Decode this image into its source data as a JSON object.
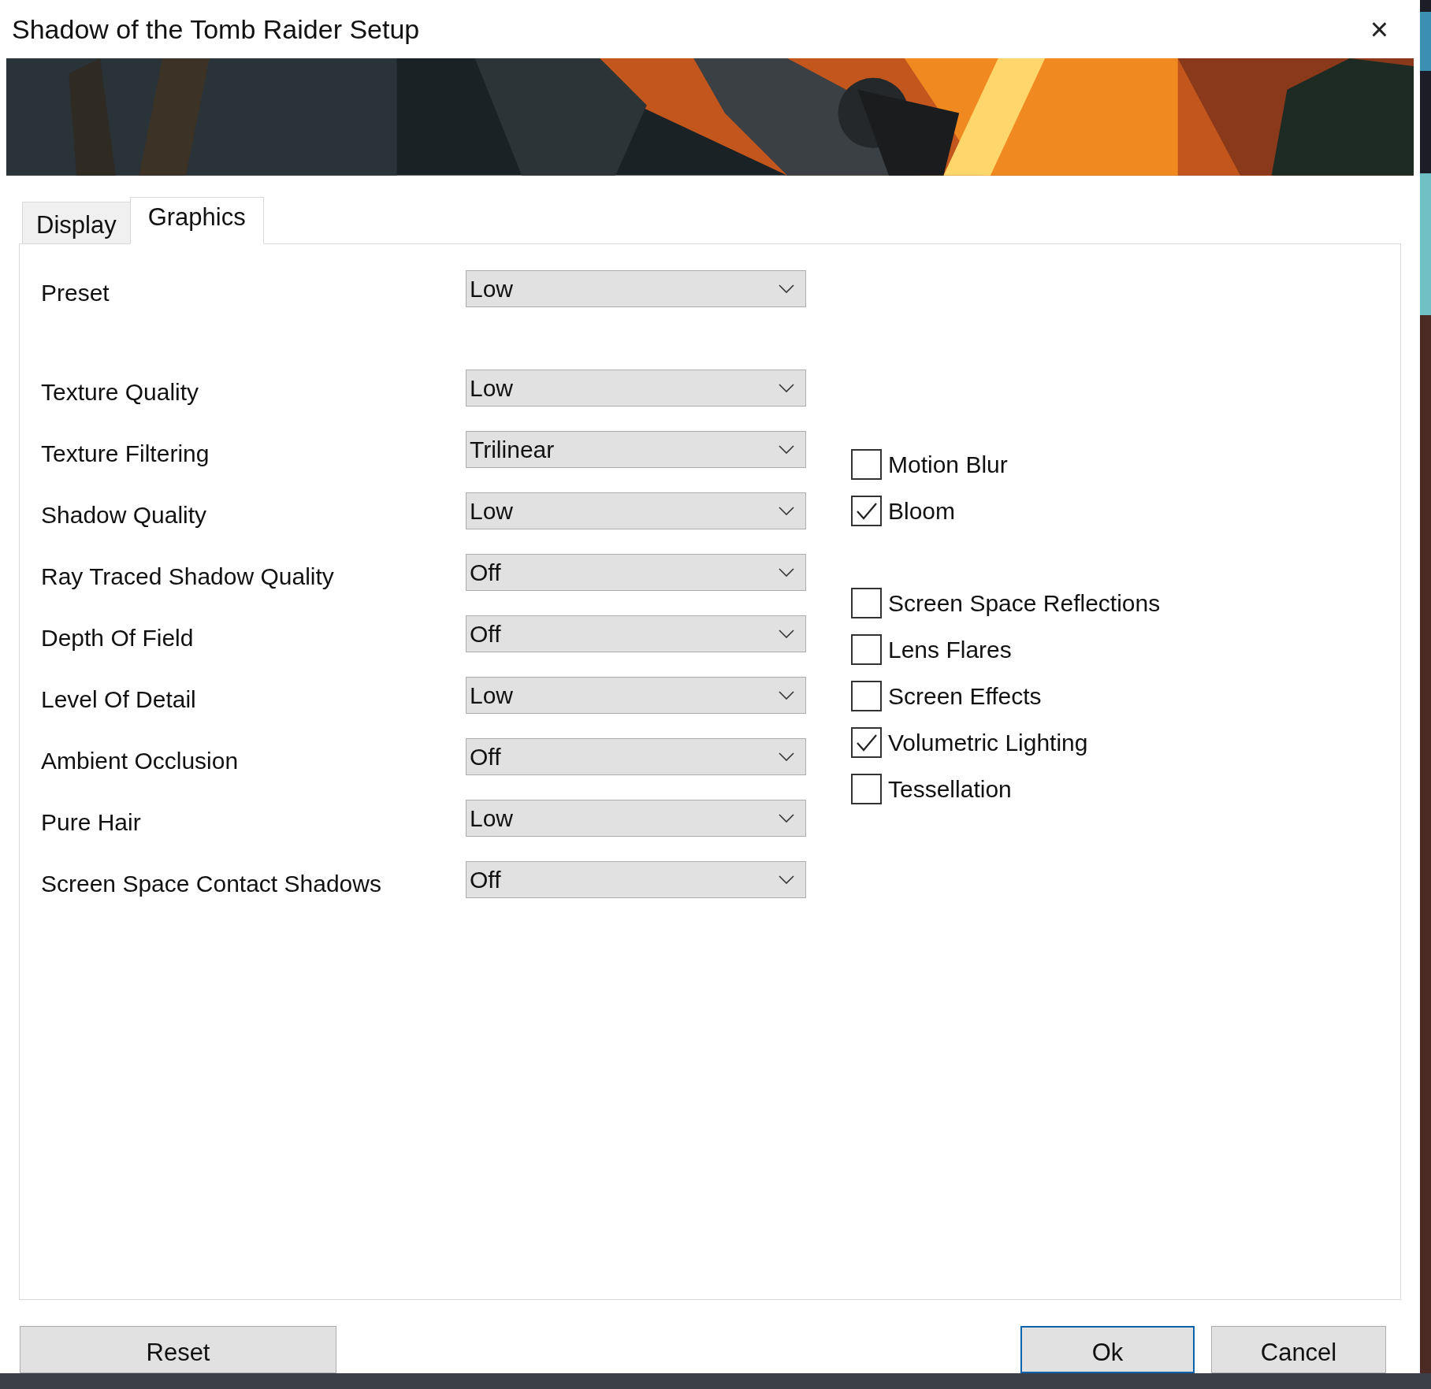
{
  "window": {
    "title": "Shadow of the Tomb Raider Setup",
    "close": "×"
  },
  "tabs": [
    {
      "label": "Display",
      "selected": false
    },
    {
      "label": "Graphics",
      "selected": true
    }
  ],
  "setting_groups": [
    [
      {
        "label": "Preset",
        "value": "Low"
      }
    ],
    [
      {
        "label": "Texture Quality",
        "value": "Low"
      },
      {
        "label": "Texture Filtering",
        "value": "Trilinear"
      },
      {
        "label": "Shadow Quality",
        "value": "Low"
      },
      {
        "label": "Ray Traced Shadow Quality",
        "value": "Off"
      },
      {
        "label": "Depth Of Field",
        "value": "Off"
      },
      {
        "label": "Level Of Detail",
        "value": "Low"
      },
      {
        "label": "Ambient Occlusion",
        "value": "Off"
      },
      {
        "label": "Pure Hair",
        "value": "Low"
      },
      {
        "label": "Screen Space Contact Shadows",
        "value": "Off"
      }
    ]
  ],
  "checkbox_groups": [
    [
      {
        "label": "Motion Blur",
        "checked": false
      },
      {
        "label": "Bloom",
        "checked": true
      }
    ],
    [
      {
        "label": "Screen Space Reflections",
        "checked": false
      },
      {
        "label": "Lens Flares",
        "checked": false
      },
      {
        "label": "Screen Effects",
        "checked": false
      },
      {
        "label": "Volumetric Lighting",
        "checked": true
      },
      {
        "label": "Tessellation",
        "checked": false
      }
    ]
  ],
  "buttons": [
    {
      "label": "Reset",
      "focused": false
    },
    {
      "label": "Ok",
      "focused": true
    },
    {
      "label": "Cancel",
      "focused": false
    }
  ]
}
